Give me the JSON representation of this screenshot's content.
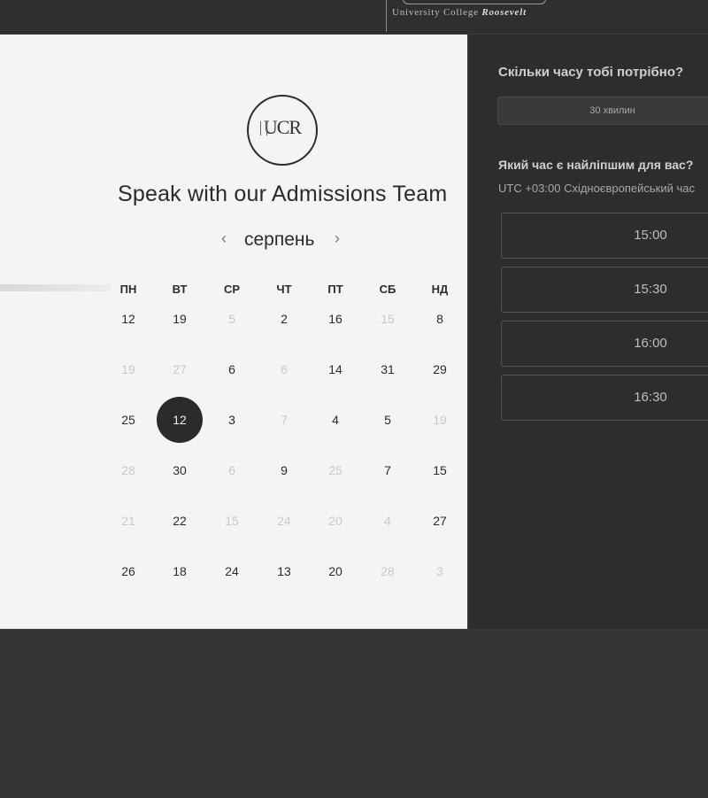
{
  "header": {
    "brand_tagline_main": "University College ",
    "brand_tagline_italic": "Roosevelt"
  },
  "calendar": {
    "logo_text": "UCR",
    "title": "Speak with our Admissions Team",
    "month": "серпень",
    "prev_symbol": "‹",
    "next_symbol": "›",
    "weekdays": [
      "ПН",
      "ВТ",
      "СР",
      "ЧТ",
      "ПТ",
      "СБ",
      "НД"
    ],
    "weeks": [
      [
        {
          "d": "12",
          "a": true
        },
        {
          "d": "19",
          "a": true
        },
        {
          "d": "5",
          "a": false
        },
        {
          "d": "2",
          "a": true
        },
        {
          "d": "16",
          "a": true
        },
        {
          "d": "15",
          "a": false
        },
        {
          "d": "8",
          "a": true
        }
      ],
      [
        {
          "d": "19",
          "a": false
        },
        {
          "d": "27",
          "a": false
        },
        {
          "d": "6",
          "a": true
        },
        {
          "d": "6",
          "a": false
        },
        {
          "d": "14",
          "a": true
        },
        {
          "d": "31",
          "a": true
        },
        {
          "d": "29",
          "a": true
        }
      ],
      [
        {
          "d": "25",
          "a": true
        },
        {
          "d": "12",
          "a": true,
          "selected": true
        },
        {
          "d": "3",
          "a": true
        },
        {
          "d": "7",
          "a": false
        },
        {
          "d": "4",
          "a": true
        },
        {
          "d": "5",
          "a": true
        },
        {
          "d": "19",
          "a": false
        }
      ],
      [
        {
          "d": "28",
          "a": false
        },
        {
          "d": "30",
          "a": true
        },
        {
          "d": "6",
          "a": false
        },
        {
          "d": "9",
          "a": true
        },
        {
          "d": "25",
          "a": false
        },
        {
          "d": "7",
          "a": true
        },
        {
          "d": "15",
          "a": true
        }
      ],
      [
        {
          "d": "21",
          "a": false
        },
        {
          "d": "22",
          "a": true
        },
        {
          "d": "15",
          "a": false
        },
        {
          "d": "24",
          "a": false
        },
        {
          "d": "20",
          "a": false
        },
        {
          "d": "4",
          "a": false
        },
        {
          "d": "27",
          "a": true
        }
      ],
      [
        {
          "d": "26",
          "a": true
        },
        {
          "d": "18",
          "a": true
        },
        {
          "d": "24",
          "a": true
        },
        {
          "d": "13",
          "a": true
        },
        {
          "d": "20",
          "a": true
        },
        {
          "d": "28",
          "a": false
        },
        {
          "d": "3",
          "a": false
        }
      ]
    ]
  },
  "scheduler": {
    "duration_question": "Скільки часу тобі потрібно?",
    "duration_value": "30 хвилин",
    "time_question": "Який час є найліпшим для вас?",
    "timezone": "UTC +03:00 Східноєвропейський час",
    "slots": [
      "15:00",
      "15:30",
      "16:00",
      "16:30"
    ]
  },
  "colors": {
    "selected_day_bg": "#2b2b2b",
    "panel_light": "#f4f4f4",
    "panel_dark": "#2d2d2d"
  }
}
